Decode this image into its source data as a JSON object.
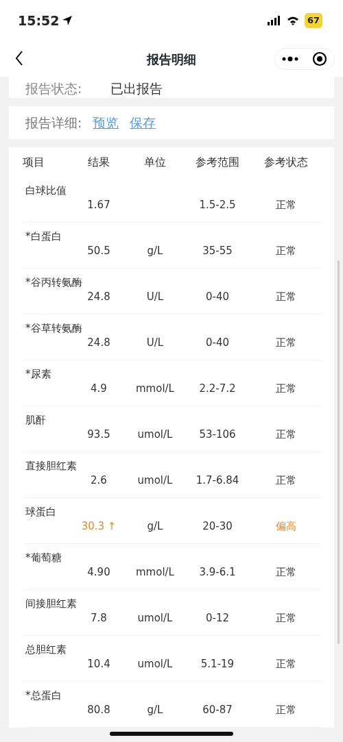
{
  "status_bar": {
    "time": "15:52",
    "battery": "67"
  },
  "nav": {
    "title": "报告明细"
  },
  "report_status": {
    "label": "报告状态:",
    "value": "已出报告"
  },
  "report_detail": {
    "label": "报告详细:",
    "links": [
      "预览",
      "保存"
    ]
  },
  "table": {
    "columns": [
      "项目",
      "结果",
      "单位",
      "参考范围",
      "参考状态"
    ],
    "rows": [
      {
        "name": "白球比值",
        "result": "1.67",
        "unit": "",
        "range": "1.5-2.5",
        "status": "正常",
        "abnormal": false
      },
      {
        "name": "*白蛋白",
        "result": "50.5",
        "unit": "g/L",
        "range": "35-55",
        "status": "正常",
        "abnormal": false
      },
      {
        "name": "*谷丙转氨酶",
        "result": "24.8",
        "unit": "U/L",
        "range": "0-40",
        "status": "正常",
        "abnormal": false
      },
      {
        "name": "*谷草转氨酶",
        "result": "24.8",
        "unit": "U/L",
        "range": "0-40",
        "status": "正常",
        "abnormal": false
      },
      {
        "name": "*尿素",
        "result": "4.9",
        "unit": "mmol/L",
        "range": "2.2-7.2",
        "status": "正常",
        "abnormal": false
      },
      {
        "name": "肌酐",
        "result": "93.5",
        "unit": "umol/L",
        "range": "53-106",
        "status": "正常",
        "abnormal": false
      },
      {
        "name": "直接胆红素",
        "result": "2.6",
        "unit": "umol/L",
        "range": "1.7-6.84",
        "status": "正常",
        "abnormal": false
      },
      {
        "name": "球蛋白",
        "result": "30.3",
        "flag": "↑",
        "unit": "g/L",
        "range": "20-30",
        "status": "偏高",
        "abnormal": true
      },
      {
        "name": "*葡萄糖",
        "result": "4.90",
        "unit": "mmol/L",
        "range": "3.9-6.1",
        "status": "正常",
        "abnormal": false
      },
      {
        "name": "间接胆红素",
        "result": "7.8",
        "unit": "umol/L",
        "range": "0-12",
        "status": "正常",
        "abnormal": false
      },
      {
        "name": "总胆红素",
        "result": "10.4",
        "unit": "umol/L",
        "range": "5.1-19",
        "status": "正常",
        "abnormal": false
      },
      {
        "name": "*总蛋白",
        "result": "80.8",
        "unit": "g/L",
        "range": "60-87",
        "status": "正常",
        "abnormal": false
      }
    ]
  }
}
